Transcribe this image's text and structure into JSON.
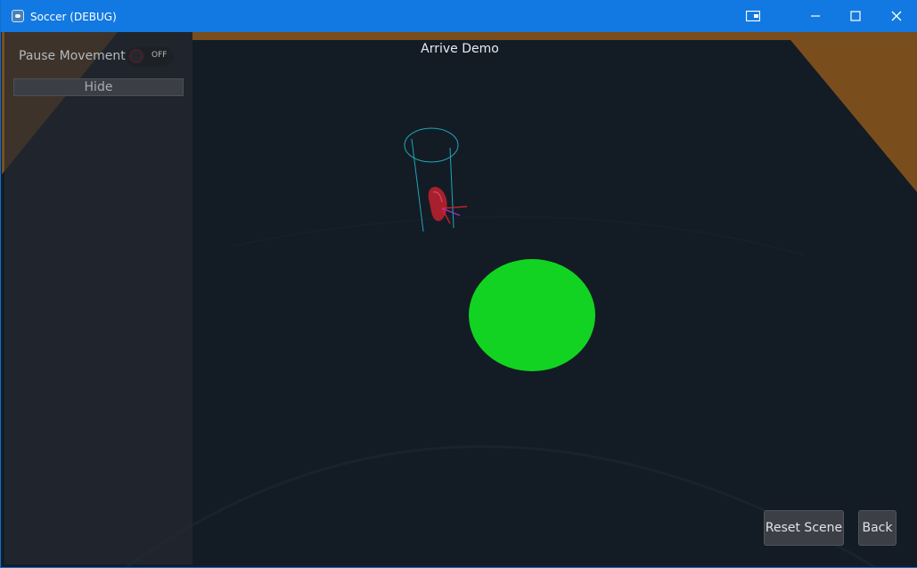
{
  "window": {
    "title": "Soccer (DEBUG)",
    "controls": [
      "screen-share-icon",
      "minimize-icon",
      "maximize-icon",
      "close-icon"
    ]
  },
  "panel": {
    "pause_label": "Pause Movement",
    "pause_toggle_state": "OFF",
    "hide_label": "Hide"
  },
  "scene": {
    "title": "Arrive Demo",
    "colors": {
      "floor": "#16202a",
      "walls": "#7a4e1c",
      "target": "#12d321",
      "agent": "#a8202e",
      "debug_lines": "#1fa6b6"
    }
  },
  "buttons": {
    "reset_label": "Reset Scene",
    "back_label": "Back"
  }
}
